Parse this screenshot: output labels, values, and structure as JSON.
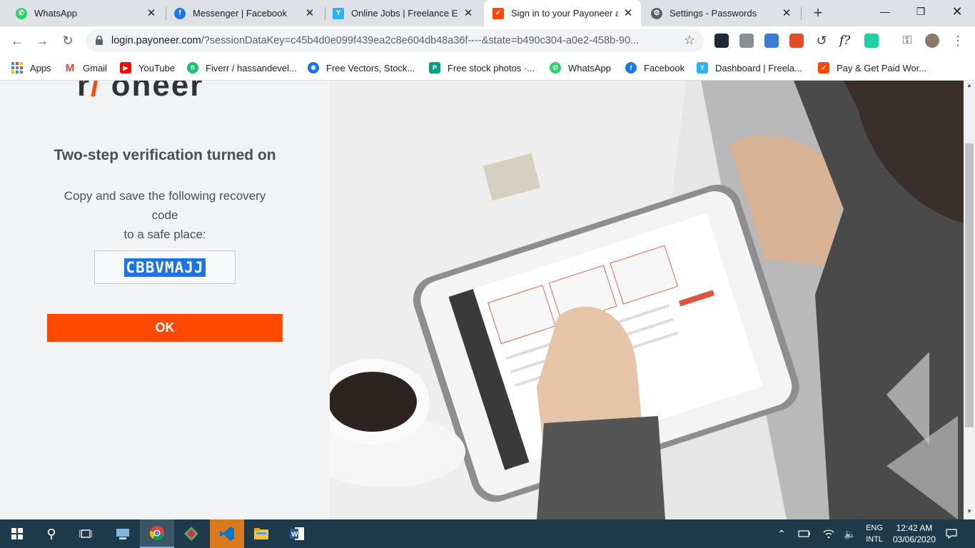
{
  "browser": {
    "tabs": [
      {
        "title": "WhatsApp",
        "icon": "whatsapp-icon",
        "color": "#25d366"
      },
      {
        "title": "Messenger | Facebook",
        "icon": "facebook-icon",
        "color": "#1877f2"
      },
      {
        "title": "Online Jobs | Freelance Em",
        "icon": "freelancer-icon",
        "color": "#29b2fe"
      },
      {
        "title": "Sign in to your Payoneer a",
        "icon": "payoneer-icon",
        "color": "#ff4800",
        "active": true
      },
      {
        "title": "Settings - Passwords",
        "icon": "gear-icon",
        "color": "#5f6368"
      }
    ],
    "new_tab": "+",
    "close_glyph": "✕",
    "url_host": "login.payoneer.com",
    "url_path": "/?sessionDataKey=c45b4d0e099f439ea2c8e604db48a36f----&state=b490c304-a0e2-458b-90...",
    "bookmarks": [
      {
        "label": "Apps",
        "icon": "apps-grid-icon",
        "color": "#4285f4"
      },
      {
        "label": "Gmail",
        "icon": "gmail-icon",
        "color": "#ea4335"
      },
      {
        "label": "YouTube",
        "icon": "youtube-icon",
        "color": "#ff0000"
      },
      {
        "label": "Fiverr / hassandevel...",
        "icon": "fiverr-icon",
        "color": "#1dbf73"
      },
      {
        "label": "Free Vectors, Stock...",
        "icon": "freepik-icon",
        "color": "#1273eb"
      },
      {
        "label": "Free stock photos ·...",
        "icon": "pexels-icon",
        "color": "#05a081"
      },
      {
        "label": "WhatsApp",
        "icon": "whatsapp-icon",
        "color": "#25d366"
      },
      {
        "label": "Facebook",
        "icon": "facebook-icon",
        "color": "#1877f2"
      },
      {
        "label": "Dashboard | Freela...",
        "icon": "freelancer-icon",
        "color": "#29b2fe"
      },
      {
        "label": "Pay & Get Paid Wor...",
        "icon": "payoneer-icon",
        "color": "#ff4800"
      }
    ]
  },
  "page": {
    "heading": "Two-step verification turned on",
    "instruction_line1": "Copy and save the following recovery code",
    "instruction_line2": "to a safe place:",
    "recovery_code": "CBBVMAJJ",
    "ok_label": "OK",
    "accent_color": "#ff4800"
  },
  "taskbar": {
    "lang_line1": "ENG",
    "lang_line2": "INTL",
    "time": "12:42 AM",
    "date": "03/06/2020"
  }
}
